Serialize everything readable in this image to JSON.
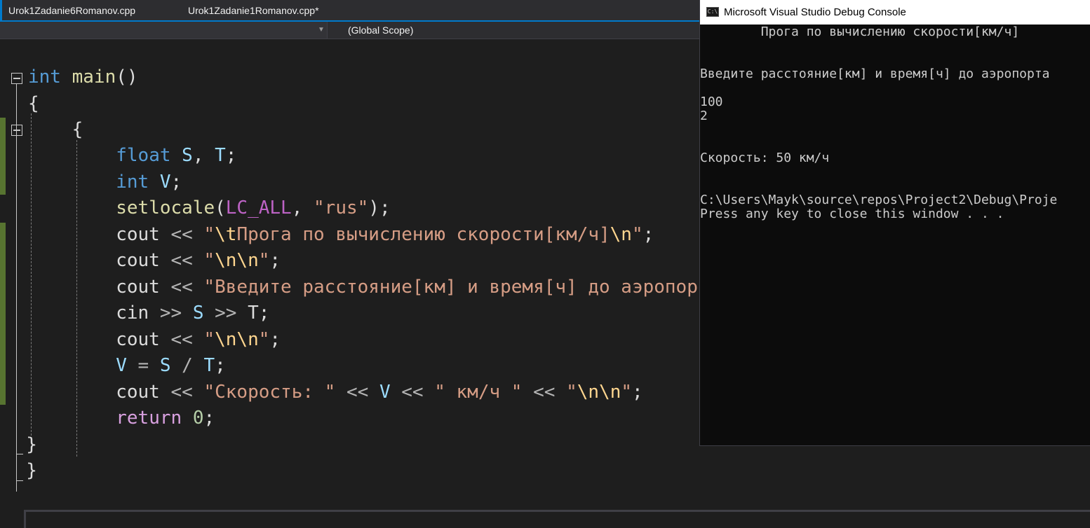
{
  "tabs": [
    {
      "label": "Urok1Zadanie6Romanov.cpp"
    },
    {
      "label": "Urok1Zadanie1Romanov.cpp*"
    }
  ],
  "navbar": {
    "scope": "(Global Scope)"
  },
  "code": {
    "l1": {
      "a": "int",
      "b": " ",
      "c": "main",
      "d": "()"
    },
    "l2": {
      "a": "{"
    },
    "l3": {
      "a": "    {"
    },
    "l4": {
      "a": "        ",
      "b": "float",
      "c": " ",
      "d": "S",
      "e": ", ",
      "f": "T",
      "g": ";"
    },
    "l5": {
      "a": "        ",
      "b": "int",
      "c": " ",
      "d": "V",
      "e": ";"
    },
    "l6": {
      "a": "        ",
      "b": "setlocale",
      "c": "(",
      "d": "LC_ALL",
      "e": ", ",
      "f": "\"rus\"",
      "g": ");"
    },
    "l7": {
      "a": "        cout ",
      "b": "<<",
      "c": " ",
      "d": "\"",
      "e": "\\t",
      "f": "Прога по вычислению скорости[км/ч]",
      "g": "\\n",
      "h": "\"",
      "i": ";"
    },
    "l8": {
      "a": "        cout ",
      "b": "<<",
      "c": " ",
      "d": "\"",
      "e": "\\n\\n",
      "f": "\"",
      "g": ";"
    },
    "l9": {
      "a": "        cout ",
      "b": "<<",
      "c": " ",
      "d": "\"Введите расстояние[км] и время[ч] до аэропор"
    },
    "l10": {
      "a": "        cin ",
      "b": ">>",
      "c": " ",
      "d": "S",
      "e": " ",
      "f": ">>",
      "g": " T;"
    },
    "l11": {
      "a": "        cout ",
      "b": "<<",
      "c": " ",
      "d": "\"",
      "e": "\\n\\n",
      "f": "\"",
      "g": ";"
    },
    "l12": {
      "a": "        ",
      "b": "V",
      "c": " ",
      "d": "=",
      "e": " ",
      "f": "S",
      "g": " ",
      "h": "/",
      "i": " ",
      "j": "T",
      "k": ";"
    },
    "l13": {
      "a": "        cout ",
      "b": "<<",
      "c": " ",
      "d": "\"Скорость: \"",
      "e": " ",
      "f": "<<",
      "g": " ",
      "h": "V",
      "i": " ",
      "j": "<<",
      "k": " ",
      "l": "\" км/ч \"",
      "m": " ",
      "n": "<<",
      "o": " ",
      "p": "\"",
      "q": "\\n\\n",
      "r": "\"",
      "s": ";"
    },
    "l14": {
      "a": "        ",
      "b": "return",
      "c": " ",
      "d": "0",
      "e": ";"
    },
    "l15": {
      "a": "  }"
    },
    "l16": {
      "a": "  }"
    }
  },
  "console": {
    "title": "Microsoft Visual Studio Debug Console",
    "icon_text": "C:\\",
    "lines": [
      "        Прога по вычислению скорости[км/ч]",
      "Введите расстояние[км] и время[ч] до аэропорта",
      "100",
      "2",
      "Скорость: 50 км/ч",
      "C:\\Users\\Mayk\\source\\repos\\Project2\\Debug\\Proje",
      "Press any key to close this window . . ."
    ]
  }
}
